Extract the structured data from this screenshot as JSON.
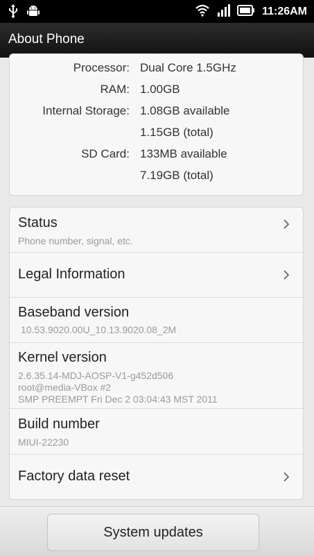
{
  "status_bar": {
    "time": "11:26AM",
    "icons": [
      "usb-icon",
      "android-debug-icon",
      "wifi-icon",
      "signal-icon",
      "battery-icon"
    ]
  },
  "title_bar": {
    "title": "About Phone"
  },
  "hardware": {
    "rows": [
      {
        "label": "Processor:",
        "value": "Dual Core 1.5GHz"
      },
      {
        "label": "RAM:",
        "value": "1.00GB"
      },
      {
        "label": "Internal Storage:",
        "value": "1.08GB available"
      },
      {
        "label": "",
        "value": "1.15GB (total)"
      },
      {
        "label": "SD Card:",
        "value": "133MB available"
      },
      {
        "label": "",
        "value": "7.19GB (total)"
      }
    ]
  },
  "list": {
    "status": {
      "title": "Status",
      "subtitle": "Phone number, signal, etc."
    },
    "legal": {
      "title": "Legal Information"
    },
    "baseband": {
      "title": "Baseband version",
      "value": "10.53.9020.00U_10.13.9020.08_2M"
    },
    "kernel": {
      "title": "Kernel version",
      "line1": "2.6.35.14-MDJ-AOSP-V1-g452d506",
      "line2": "root@media-VBox #2",
      "line3": "SMP PREEMPT Fri Dec 2 03:04:43 MST 2011"
    },
    "build": {
      "title": "Build number",
      "value": "MIUI-22230"
    },
    "factory_reset": {
      "title": "Factory data reset"
    }
  },
  "bottom": {
    "system_updates_label": "System updates"
  },
  "colors": {
    "status_bar_bg": "#000000",
    "title_bar_bg": "#1a1a1a",
    "card_bg": "#f7f7f7",
    "page_bg": "#e9e9e9"
  }
}
